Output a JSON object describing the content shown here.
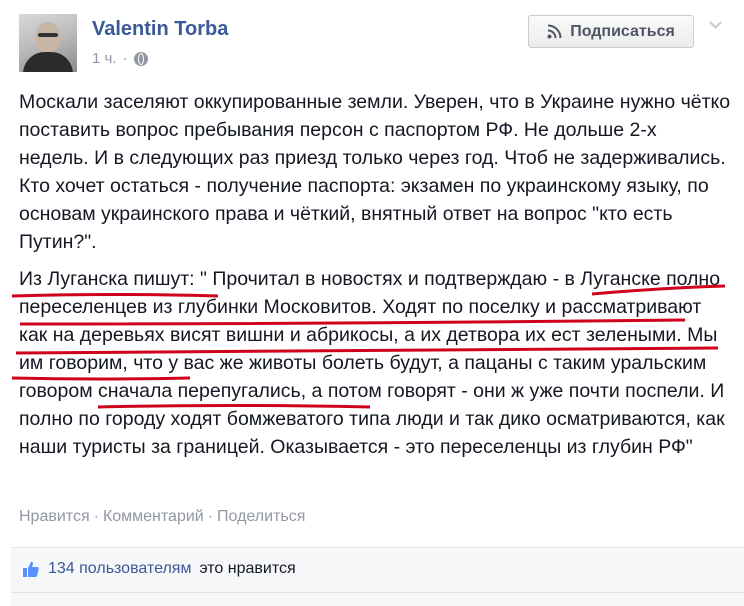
{
  "post": {
    "author": "Valentin Torba",
    "time": "1 ч.",
    "subscribe_label": "Подписаться",
    "paragraph1": "Москали заселяют оккупированные земли. Уверен, что в Украине нужно чётко поставить вопрос пребывания персон с паспортом РФ. Не дольше 2-х недель. И в следующих раз приезд только через год. Чтоб не задерживались. Кто хочет остаться - получение паспорта: экзамен по украинскому языку, по основам украинского права и чёткий, внятный ответ на вопрос \"кто есть Путин?\".",
    "paragraph2": "Из Луганска пишут: \" Прочитал в новостях и подтверждаю - в Луганске полно переселенцев из глубинки Московитов. Ходят по поселку и рассматривают как на деревьях висят вишни и абрикосы, а их детвора их ест зелеными. Мы им говорим, что у вас же животы болеть будут, а пацаны с таким уральским говором сначала перепугались, а потом говорят - они ж уже почти поспели. И полно по городу ходят бомжеватого типа люди и так дико осматриваются, как наши туристы за границей. Оказывается - это переселенцы из глубин РФ\""
  },
  "actions": {
    "like": "Нравится",
    "comment": "Комментарий",
    "share": "Поделиться",
    "separator": "·"
  },
  "likes": {
    "count_text": "134 пользователям",
    "rest_text": "это нравится"
  },
  "colors": {
    "link": "#3b5998",
    "muted": "#9197a3",
    "underline": "#d0021b"
  }
}
